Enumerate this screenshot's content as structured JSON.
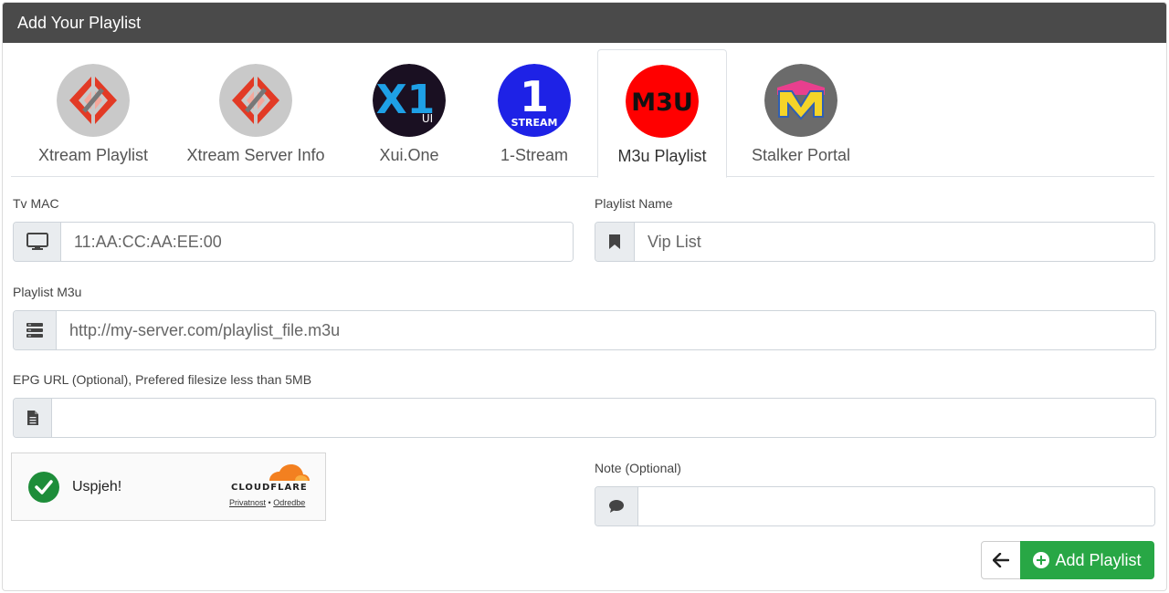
{
  "header": {
    "title": "Add Your Playlist"
  },
  "tabs": [
    {
      "label": "Xtream Playlist",
      "icon": "xtream-logo-icon"
    },
    {
      "label": "Xtream Server Info",
      "icon": "xtream-logo-icon"
    },
    {
      "label": "Xui.One",
      "icon": "xui-one-logo-icon",
      "logo_text": "X1",
      "logo_sub": "UI"
    },
    {
      "label": "1-Stream",
      "icon": "one-stream-logo-icon",
      "logo_text": "1",
      "logo_sub": "STREAM"
    },
    {
      "label": "M3u Playlist",
      "icon": "m3u-logo-icon",
      "logo_text": "M3U",
      "active": true
    },
    {
      "label": "Stalker Portal",
      "icon": "stalker-portal-logo-icon"
    }
  ],
  "form": {
    "tv_mac": {
      "label": "Tv MAC",
      "placeholder": "11:AA:CC:AA:EE:00",
      "icon": "monitor-icon"
    },
    "playlist_name": {
      "label": "Playlist Name",
      "placeholder": "Vip List",
      "icon": "bookmark-icon"
    },
    "playlist_m3u": {
      "label": "Playlist M3u",
      "placeholder": "http://my-server.com/playlist_file.m3u",
      "icon": "server-icon"
    },
    "epg_url": {
      "label": "EPG URL (Optional), Prefered filesize less than 5MB",
      "placeholder": "",
      "icon": "file-icon"
    },
    "note": {
      "label": "Note (Optional)",
      "placeholder": "",
      "icon": "comment-icon"
    }
  },
  "captcha": {
    "status": "Uspjeh!",
    "brand": "CLOUDFLARE",
    "privacy_link": "Privatnost",
    "separator": "•",
    "terms_link": "Odredbe"
  },
  "buttons": {
    "add_label": "Add Playlist"
  },
  "colors": {
    "header_bg": "#4a4a4a",
    "accent_green": "#28a745",
    "cloudflare_orange": "#f38020"
  }
}
